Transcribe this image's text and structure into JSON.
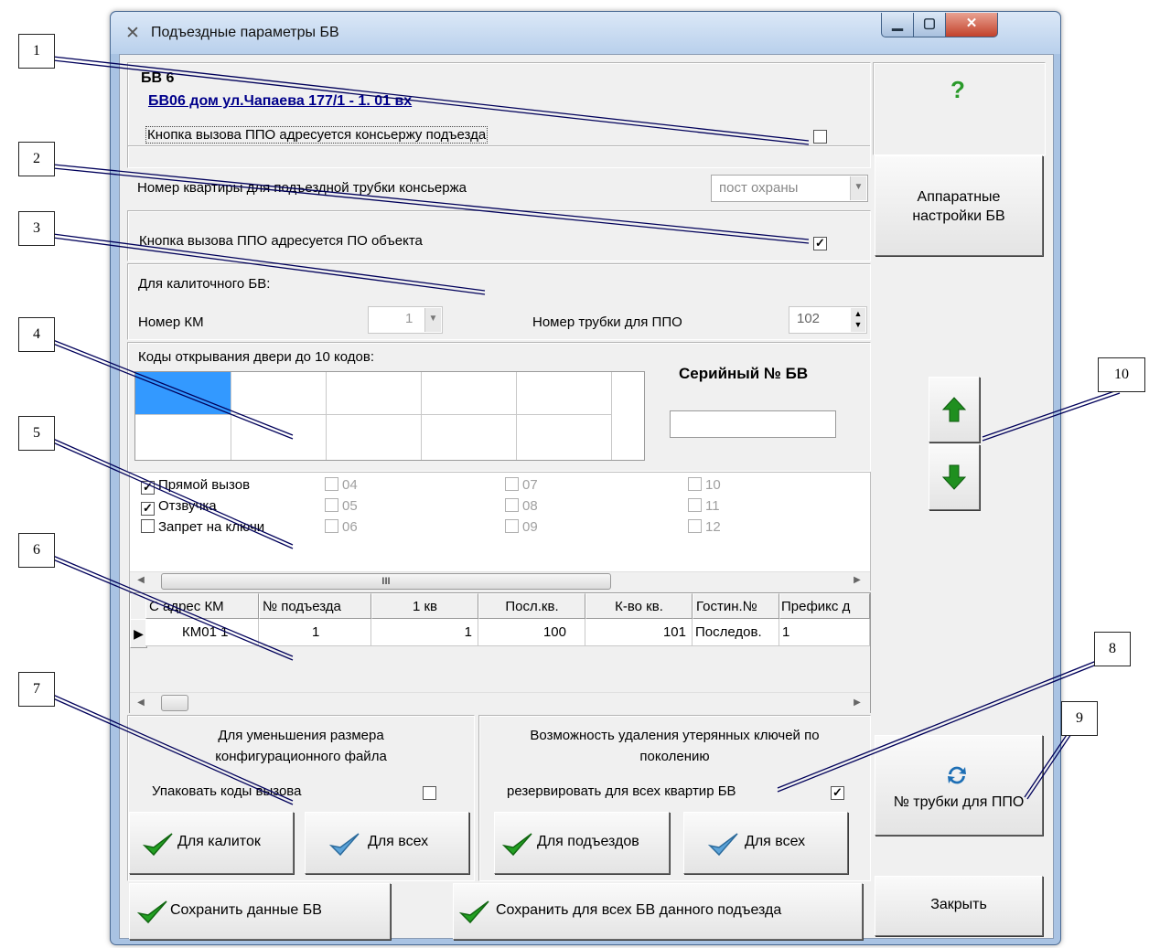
{
  "window": {
    "title": "Подъездные параметры БВ",
    "icons": [
      "tools-icon",
      "minimize-icon",
      "maximize-icon",
      "close-icon"
    ]
  },
  "header": {
    "bv_label": "БВ   6",
    "bv_link": "БВ06 дом ул.Чапаева 177/1 -   1. 01 вх"
  },
  "concierge": {
    "checkbox_label": "Кнопка вызова ППО адресуется консьержу подъезда",
    "checked": false,
    "apartment_label": "Номер квартиры для подъездной трубки консьержа",
    "apartment_value": "пост охраны"
  },
  "object_po": {
    "checkbox_label": "Кнопка вызова ППО адресуется ПО объекта",
    "checked": true
  },
  "gate": {
    "heading": "Для калиточного БВ:",
    "km_label": "Номер КМ",
    "km_value": "1",
    "tube_label": "Номер трубки для ППО",
    "tube_value": "102"
  },
  "codes": {
    "heading": "Коды открывания двери до 10 кодов:",
    "serial_label": "Серийный № БВ",
    "serial_value": ""
  },
  "options": {
    "col1": [
      {
        "label": "Прямой вызов",
        "checked": true
      },
      {
        "label": "Отзвучка",
        "checked": true
      },
      {
        "label": "Запрет на ключи",
        "checked": false
      }
    ],
    "col2": [
      "04",
      "05",
      "06"
    ],
    "col3": [
      "07",
      "08",
      "09"
    ],
    "col4": [
      "10",
      "11",
      "12"
    ],
    "scroll_thumb_glyph": "III"
  },
  "table": {
    "headers": [
      "С адрес КМ",
      "№ подъезда",
      "1 кв",
      "Посл.кв.",
      "К-во кв.",
      "Гостин.№",
      "Префикс д"
    ],
    "rows": [
      [
        "КМ01   1",
        "1",
        "1",
        "100",
        "101",
        "Последов.",
        "1"
      ]
    ]
  },
  "pack": {
    "heading": "Для уменьшения размера конфигурационного файла",
    "checkbox_label": "Упаковать коды вызова",
    "checked": false,
    "btn_gates": "Для калиток",
    "btn_all": "Для всех"
  },
  "lost_keys": {
    "heading": "Возможность удаления утерянных ключей по поколению",
    "checkbox_label": "резервировать для всех квартир БВ",
    "checked": true,
    "btn_entrances": "Для подъездов",
    "btn_all": "Для всех"
  },
  "save": {
    "btn_save": "Сохранить данные БВ",
    "btn_save_all": "Сохранить для всех БВ данного подъезда"
  },
  "right": {
    "help_glyph": "?",
    "hw_settings": "Аппаратные настройки БВ",
    "tube_btn": "№ трубки для ППО",
    "close_btn": "Закрыть",
    "colors": {
      "arrow_green": "#1f8f1f",
      "help_green": "#2a9a2a",
      "refresh_blue": "#1e6fb5",
      "selection_blue": "#3399ff"
    }
  },
  "callouts": [
    "1",
    "2",
    "3",
    "4",
    "5",
    "6",
    "7",
    "8",
    "9",
    "10"
  ]
}
